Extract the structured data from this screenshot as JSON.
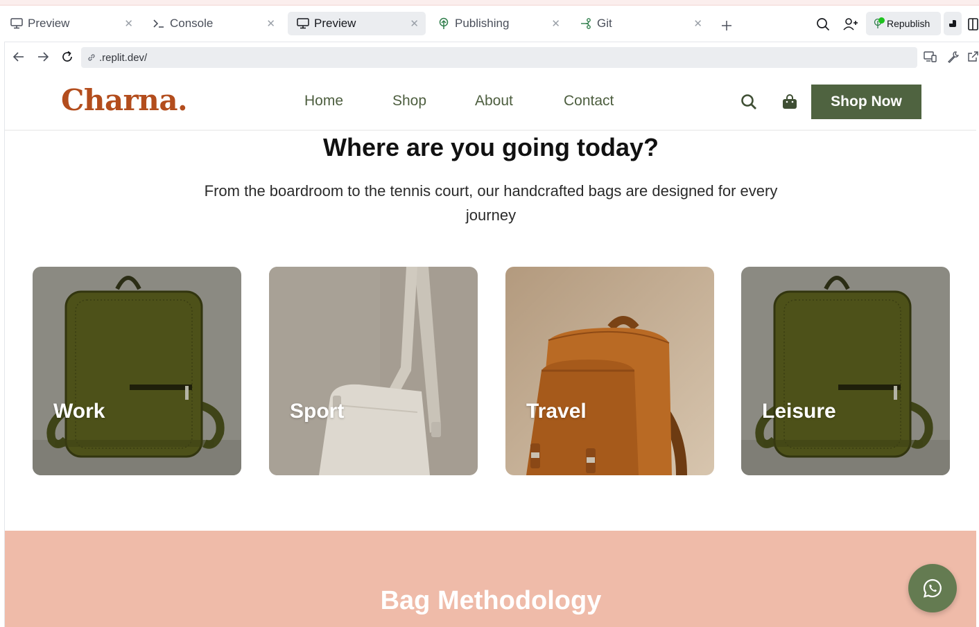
{
  "browser": {
    "tabs": [
      {
        "label": "Preview",
        "icon": "monitor-icon",
        "active": false
      },
      {
        "label": "Console",
        "icon": "terminal-icon",
        "active": false
      },
      {
        "label": "Preview",
        "icon": "monitor-icon",
        "active": true
      },
      {
        "label": "Publishing",
        "icon": "publish-icon",
        "active": false
      },
      {
        "label": "Git",
        "icon": "git-icon",
        "active": false
      }
    ],
    "republish_label": "Republish",
    "url": ".replit.dev/"
  },
  "site": {
    "logo": "Charna.",
    "nav": [
      "Home",
      "Shop",
      "About",
      "Contact"
    ],
    "cta": "Shop Now",
    "heading": "Where are you going today?",
    "lead": "From the boardroom to the tennis court, our handcrafted bags are designed for every journey",
    "categories": [
      {
        "label": "Work"
      },
      {
        "label": "Sport"
      },
      {
        "label": "Travel"
      },
      {
        "label": "Leisure"
      }
    ],
    "section_title": "Bag Methodology"
  },
  "colors": {
    "brand": "#b34d1d",
    "accent": "#4f6340",
    "pink_section": "#efbba9",
    "whatsapp_button": "#647b51"
  }
}
